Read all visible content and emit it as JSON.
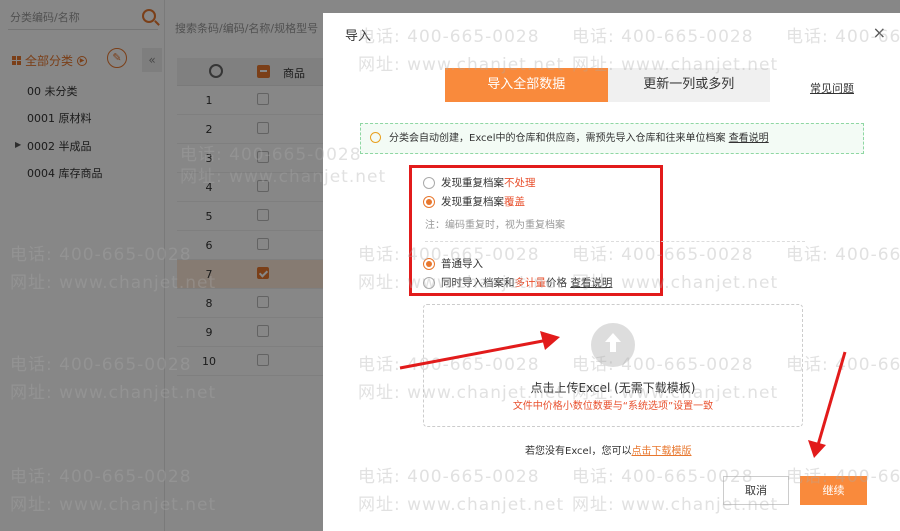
{
  "left": {
    "search_placeholder": "分类编码/名称",
    "all_category": "全部分类",
    "items": [
      "00 未分类",
      "0001 原材料",
      "0002 半成品",
      "0004 库存商品"
    ],
    "collapse_glyph": "«",
    "edit_glyph": "✎"
  },
  "table": {
    "search_placeholder": "搜索条码/编码/名称/规格型号",
    "column": "商品",
    "rows": [
      "1",
      "2",
      "3",
      "4",
      "5",
      "6",
      "7",
      "8",
      "9",
      "10"
    ],
    "selected_row": "7"
  },
  "dialog": {
    "title": "导入",
    "close_glyph": "×",
    "tabs": [
      "导入全部数据",
      "更新一列或多列"
    ],
    "faq": "常见问题",
    "notice": "分类会自动创建，Excel中的仓库和供应商，需预先导入仓库和往来单位档案",
    "notice_link": "查看说明",
    "dup_opt1_prefix": "发现重复档案",
    "dup_opt1_red": "不处理",
    "dup_opt2_prefix": "发现重复档案",
    "dup_opt2_red": "覆盖",
    "note": "注：编码重复时，视为重复档案",
    "imp_opt1": "普通导入",
    "imp_opt2_prefix": "同时导入档案和",
    "imp_opt2_red": "多计量",
    "imp_opt2_suffix": "价格",
    "imp_opt2_link": "查看说明",
    "upload_title": "点击上传Excel (无需下载模板)",
    "upload_sub": "文件中价格小数位数要与“系统选项”设置一致",
    "no_excel": "若您没有Excel，您可以",
    "no_excel_link": "点击下载模版",
    "cancel": "取消",
    "next": "继续"
  },
  "watermark": {
    "phone": "电话: 400-665-0028",
    "site": "网址: www.chanjet.net"
  },
  "colors": {
    "accent": "#f98a3c",
    "highlight": "#e21b1b"
  }
}
